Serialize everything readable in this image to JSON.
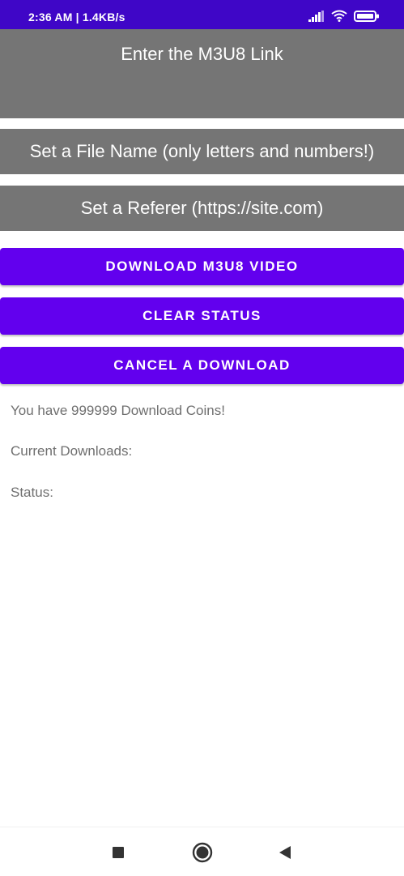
{
  "status_bar": {
    "time_speed": "2:36 AM | 1.4KB/s",
    "icons": [
      "signal-icon",
      "wifi-icon",
      "battery-icon"
    ],
    "color": "#3f06c7"
  },
  "form": {
    "link_placeholder": "Enter the M3U8 Link",
    "filename_placeholder": "Set a File Name (only letters and numbers!)",
    "referer_placeholder": "Set a Referer (https://site.com)",
    "field_color": "#757575"
  },
  "buttons": {
    "download": "DOWNLOAD M3U8 VIDEO",
    "clear": "CLEAR STATUS",
    "cancel": "CANCEL A DOWNLOAD",
    "color": "#6200ee"
  },
  "info": {
    "coins": "You have 999999 Download Coins!",
    "current_downloads": "Current Downloads:",
    "status": "Status:"
  },
  "nav_bar": {
    "icons": [
      "recents-square-icon",
      "home-circle-icon",
      "back-triangle-icon"
    ]
  }
}
